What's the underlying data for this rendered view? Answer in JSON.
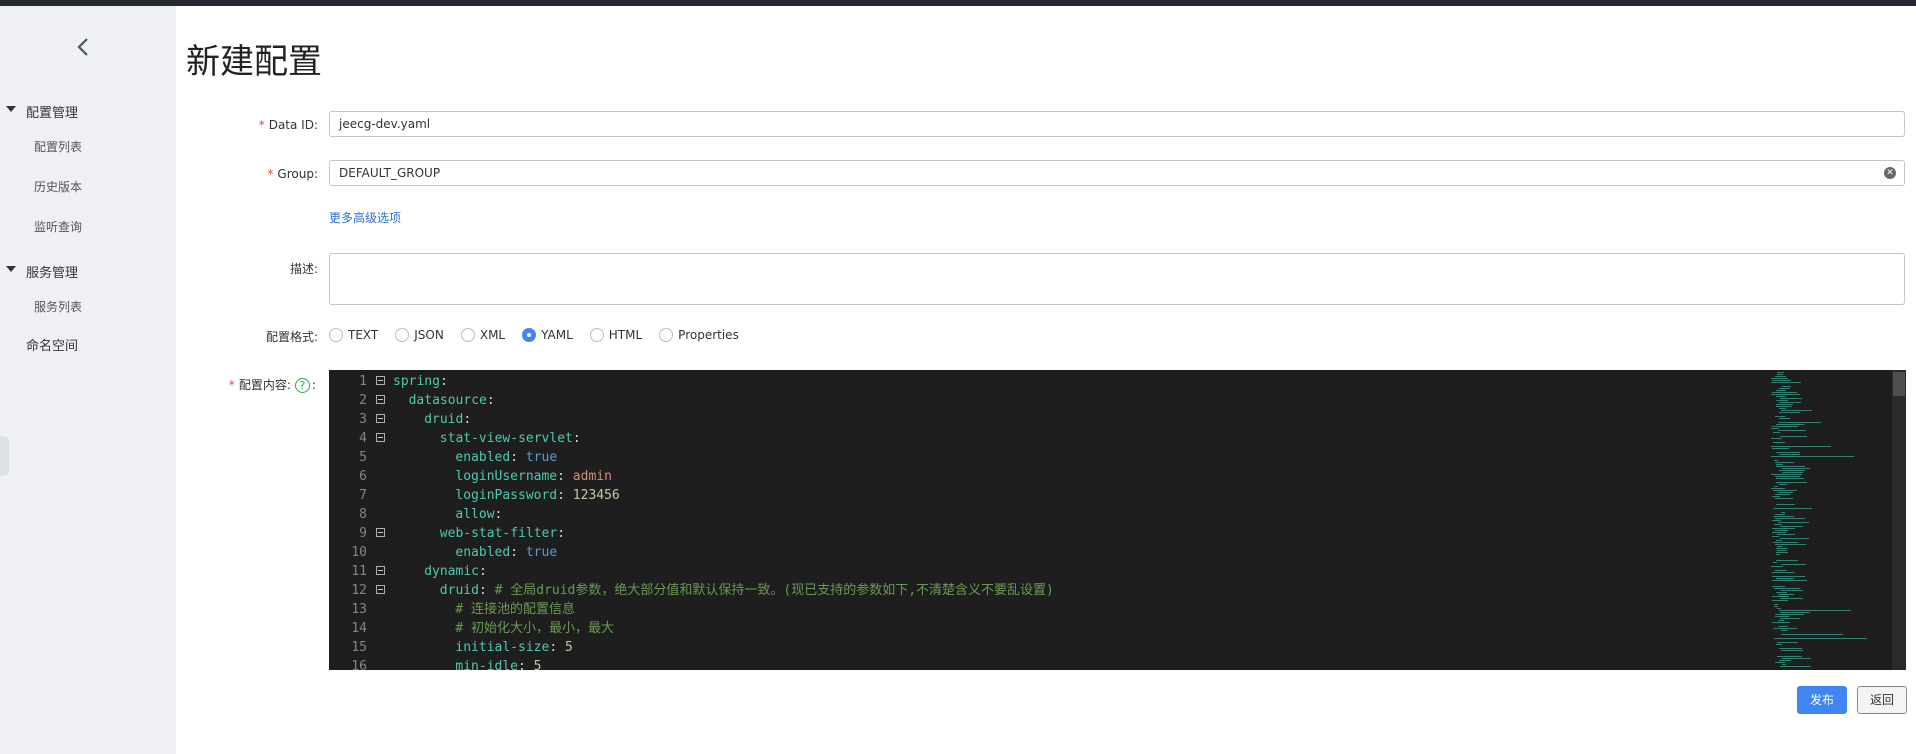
{
  "sidebar": {
    "groups": [
      {
        "label": "配置管理",
        "items": [
          "配置列表",
          "历史版本",
          "监听查询"
        ]
      },
      {
        "label": "服务管理",
        "items": [
          "服务列表"
        ]
      }
    ],
    "top_item": "命名空间"
  },
  "page": {
    "title": "新建配置"
  },
  "form": {
    "data_id": {
      "label": "Data ID:",
      "value": "jeecg-dev.yaml"
    },
    "group": {
      "label": "Group:",
      "value": "DEFAULT_GROUP"
    },
    "more_options": "更多高级选项",
    "description": {
      "label": "描述:",
      "value": ""
    },
    "format": {
      "label": "配置格式:",
      "options": [
        "TEXT",
        "JSON",
        "XML",
        "YAML",
        "HTML",
        "Properties"
      ],
      "selected": "YAML"
    },
    "content": {
      "label": "配置内容:",
      "colon": ":"
    }
  },
  "editor": {
    "lines": [
      {
        "n": "1",
        "fold": true,
        "indent": 0,
        "key": "spring",
        "sep": ":",
        "val": "",
        "vtype": "",
        "comment": ""
      },
      {
        "n": "2",
        "fold": true,
        "indent": 2,
        "key": "datasource",
        "sep": ":",
        "val": "",
        "vtype": "",
        "comment": ""
      },
      {
        "n": "3",
        "fold": true,
        "indent": 4,
        "key": "druid",
        "sep": ":",
        "val": "",
        "vtype": "",
        "comment": ""
      },
      {
        "n": "4",
        "fold": true,
        "indent": 6,
        "key": "stat-view-servlet",
        "sep": ":",
        "val": "",
        "vtype": "",
        "comment": ""
      },
      {
        "n": "5",
        "fold": false,
        "indent": 8,
        "key": "enabled",
        "sep": ": ",
        "val": "true",
        "vtype": "b",
        "comment": ""
      },
      {
        "n": "6",
        "fold": false,
        "indent": 8,
        "key": "loginUsername",
        "sep": ": ",
        "val": "admin",
        "vtype": "s",
        "comment": ""
      },
      {
        "n": "7",
        "fold": false,
        "indent": 8,
        "key": "loginPassword",
        "sep": ": ",
        "val": "123456",
        "vtype": "n",
        "comment": ""
      },
      {
        "n": "8",
        "fold": false,
        "indent": 8,
        "key": "allow",
        "sep": ":",
        "val": "",
        "vtype": "",
        "comment": ""
      },
      {
        "n": "9",
        "fold": true,
        "indent": 6,
        "key": "web-stat-filter",
        "sep": ":",
        "val": "",
        "vtype": "",
        "comment": ""
      },
      {
        "n": "10",
        "fold": false,
        "indent": 8,
        "key": "enabled",
        "sep": ": ",
        "val": "true",
        "vtype": "b",
        "comment": ""
      },
      {
        "n": "11",
        "fold": true,
        "indent": 4,
        "key": "dynamic",
        "sep": ":",
        "val": "",
        "vtype": "",
        "comment": ""
      },
      {
        "n": "12",
        "fold": true,
        "indent": 6,
        "key": "druid",
        "sep": ": ",
        "val": "",
        "vtype": "",
        "comment": "# 全局druid参数，绝大部分值和默认保持一致。(现已支持的参数如下,不清楚含义不要乱设置)"
      },
      {
        "n": "13",
        "fold": false,
        "indent": 8,
        "key": "",
        "sep": "",
        "val": "",
        "vtype": "",
        "comment": "# 连接池的配置信息"
      },
      {
        "n": "14",
        "fold": false,
        "indent": 8,
        "key": "",
        "sep": "",
        "val": "",
        "vtype": "",
        "comment": "# 初始化大小，最小，最大"
      },
      {
        "n": "15",
        "fold": false,
        "indent": 8,
        "key": "initial-size",
        "sep": ": ",
        "val": "5",
        "vtype": "n",
        "comment": ""
      },
      {
        "n": "16",
        "fold": false,
        "indent": 8,
        "key": "min-idle",
        "sep": ": ",
        "val": "5",
        "vtype": "n",
        "comment": ""
      }
    ]
  },
  "actions": {
    "publish": "发布",
    "back": "返回"
  }
}
